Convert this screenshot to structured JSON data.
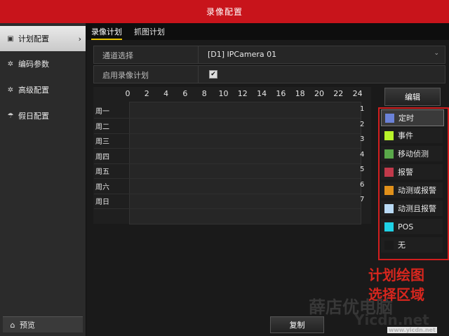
{
  "window": {
    "title": "录像配置"
  },
  "sidebar": {
    "items": [
      {
        "icon": "calendar-icon",
        "label": "计划配置"
      },
      {
        "icon": "gear-icon",
        "label": "编码参数"
      },
      {
        "icon": "settings-icon",
        "label": "高级配置"
      },
      {
        "icon": "umbrella-icon",
        "label": "假日配置"
      }
    ],
    "preview_label": "预览"
  },
  "tabs": [
    {
      "label": "录像计划"
    },
    {
      "label": "抓图计划"
    }
  ],
  "form": {
    "channel_label": "通道选择",
    "channel_value": "[D1] IPCamera 01",
    "enable_label": "启用录像计划",
    "enable_checked": true
  },
  "schedule": {
    "hours": [
      "0",
      "2",
      "4",
      "6",
      "8",
      "10",
      "12",
      "14",
      "16",
      "18",
      "20",
      "22",
      "24"
    ],
    "days": [
      "周一",
      "周二",
      "周三",
      "周四",
      "周五",
      "周六",
      "周日"
    ],
    "day_indices": [
      "1",
      "2",
      "3",
      "4",
      "5",
      "6",
      "7"
    ]
  },
  "buttons": {
    "edit": "编辑",
    "copy": "复制"
  },
  "legend": [
    {
      "label": "定时",
      "color": "#6b82d8"
    },
    {
      "label": "事件",
      "color": "#b8f52a"
    },
    {
      "label": "移动侦测",
      "color": "#59a84a"
    },
    {
      "label": "报警",
      "color": "#c0394a"
    },
    {
      "label": "动测或报警",
      "color": "#e0901a"
    },
    {
      "label": "动测且报警",
      "color": "#b9daf5"
    },
    {
      "label": "POS",
      "color": "#1fd2e6"
    },
    {
      "label": "无",
      "color": "#1a1a1a"
    }
  ],
  "annotation": {
    "line1": "计划绘图",
    "line2": "选择区域"
  },
  "watermark": {
    "text1": "薛店优电脑",
    "text2": "Yicdn.net",
    "text3": "www.yicdn.net"
  }
}
